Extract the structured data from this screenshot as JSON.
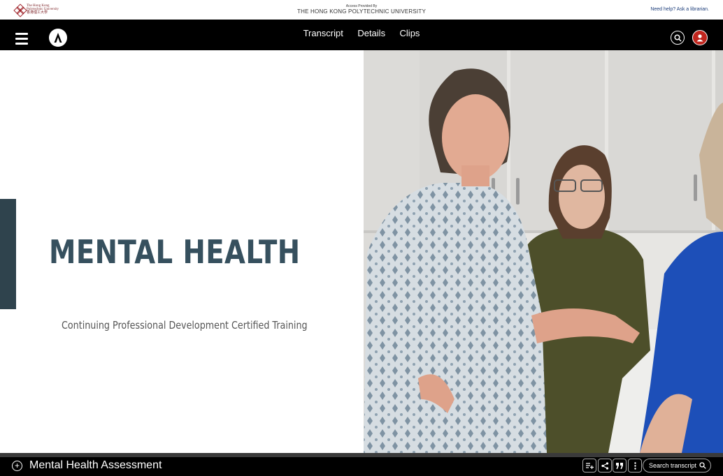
{
  "institution": {
    "logo_text_line1": "The Hong Kong",
    "logo_text_line2": "Polytechnic University",
    "logo_text_line3": "香港理工大學",
    "access_label": "Access Provided By",
    "access_name": "THE HONG KONG POLYTECHNIC UNIVERSITY",
    "help_text": "Need help? Ask a librarian."
  },
  "nav": {
    "tabs": [
      "Transcript",
      "Details",
      "Clips"
    ],
    "brand_letter": "A"
  },
  "video": {
    "slide_title": "MENTAL HEALTH",
    "slide_subtitle": "Continuing Professional Development Certified Training"
  },
  "player": {
    "title": "Mental Health Assessment",
    "search_placeholder": "Search transcript"
  },
  "colors": {
    "accent_red": "#c0261e",
    "slide_title": "#36505e",
    "slide_bar": "#2f434d"
  }
}
